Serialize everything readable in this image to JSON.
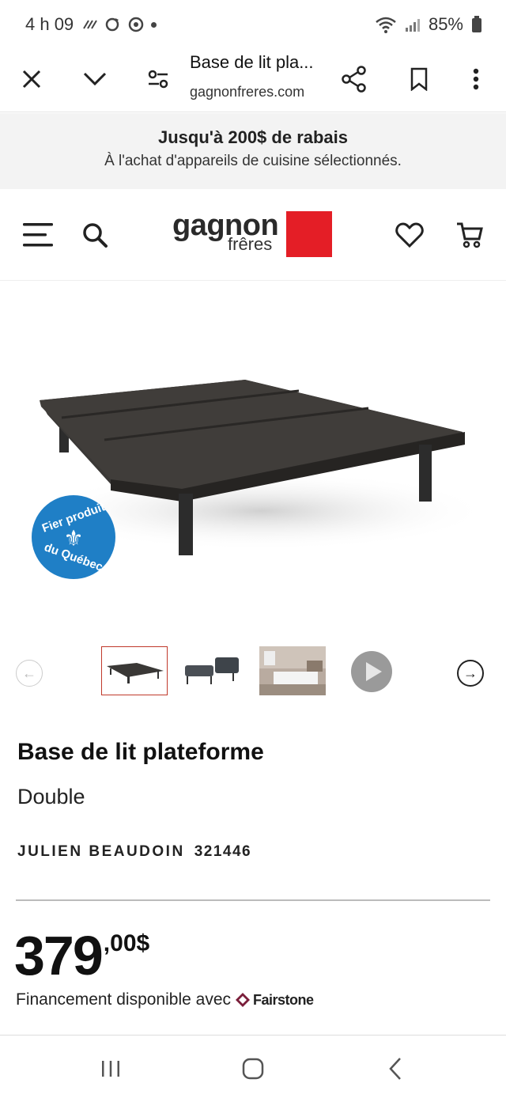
{
  "status_bar": {
    "time": "4 h 09",
    "battery": "85%"
  },
  "browser": {
    "title": "Base de lit pla...",
    "url": "gagnonfreres.com"
  },
  "promo": {
    "title": "Jusqu'à 200$ de rabais",
    "subtitle": "À l'achat d'appareils de cuisine sélectionnés."
  },
  "logo": {
    "word": "gagnon",
    "sub": "frêres"
  },
  "badge": {
    "top": "Fier produit",
    "bottom": "du Québec"
  },
  "product": {
    "title": "Base de lit plateforme",
    "size": "Double",
    "brand": "JULIEN BEAUDOIN",
    "sku": "321446",
    "price_main": "379",
    "price_cents": ",00$",
    "financing": "Financement disponible avec",
    "financing_partner": "Fairstone"
  },
  "colors": {
    "brand_red": "#e41e26",
    "badge_blue": "#1f7fc6"
  }
}
